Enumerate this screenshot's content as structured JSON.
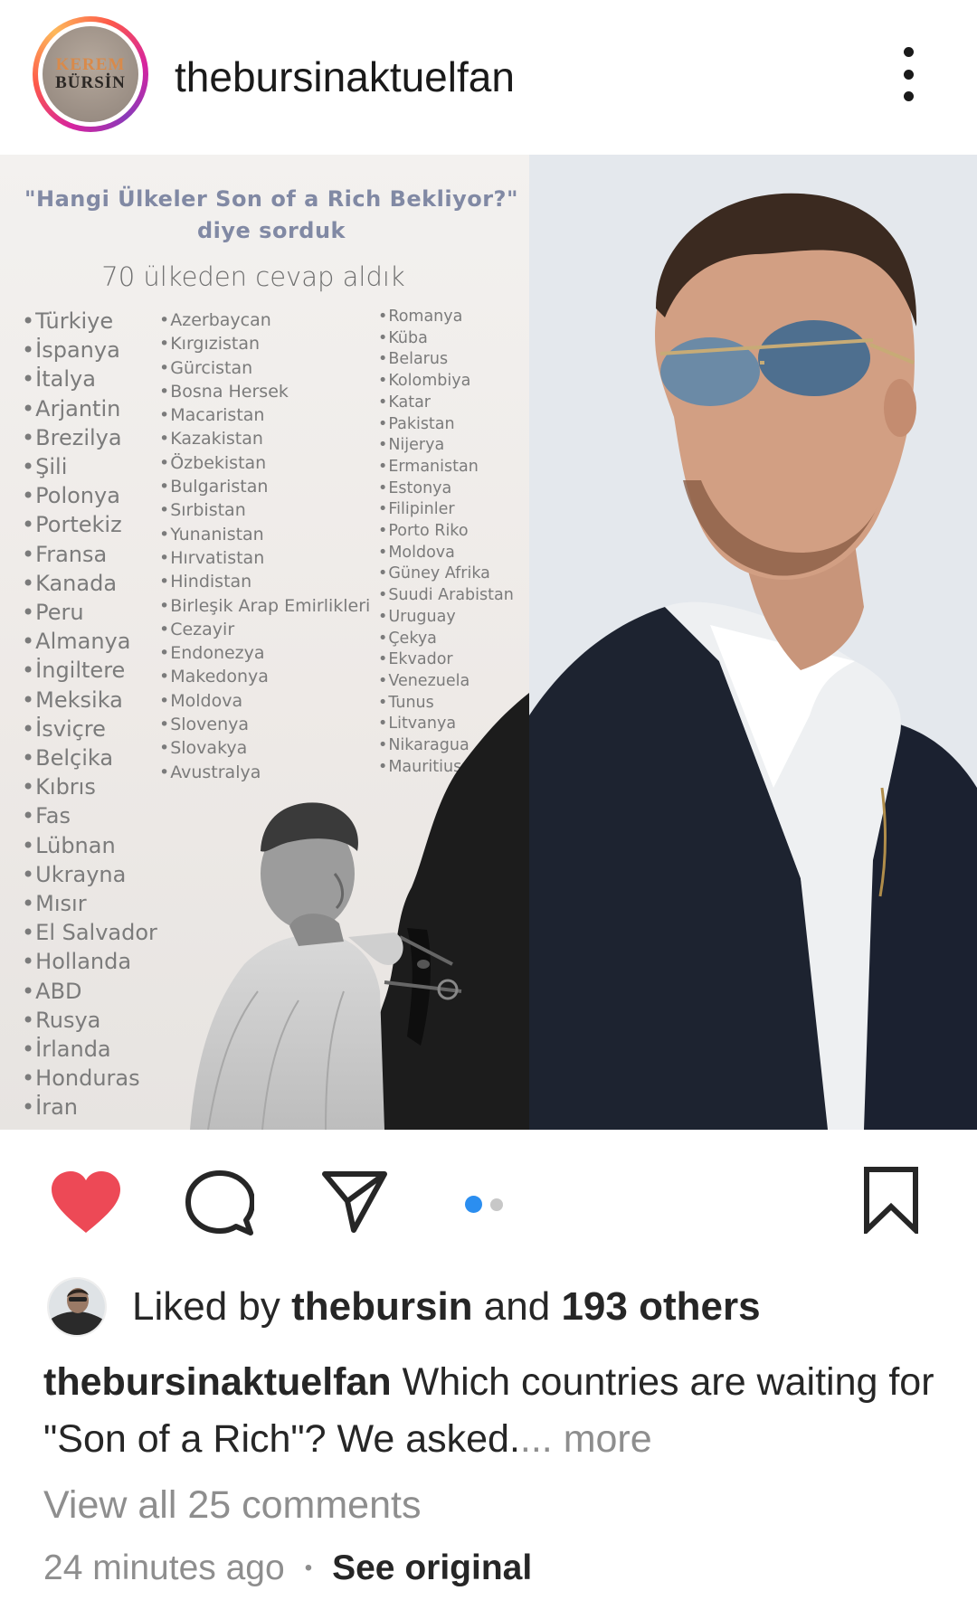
{
  "header": {
    "avatar_text_line1": "KEREM",
    "avatar_text_line2": "BÜRSİN",
    "username": "thebursinaktuelfan",
    "more_icon": "more-vertical-icon"
  },
  "post_image": {
    "question_line1": "\"Hangi Ülkeler Son of a Rich Bekliyor?\"",
    "question_line2": "diye sorduk",
    "subtitle": "70 ülkeden cevap aldık",
    "column1": [
      "Türkiye",
      "İspanya",
      "İtalya",
      "Arjantin",
      "Brezilya",
      "Şili",
      "Polonya",
      "Portekiz",
      "Fransa",
      "Kanada",
      "Peru",
      "Almanya",
      "İngiltere",
      "Meksika",
      "İsviçre",
      "Belçika",
      "Kıbrıs",
      "Fas",
      "Lübnan",
      "Ukrayna",
      "Mısır",
      "El Salvador",
      "Hollanda",
      "ABD",
      "Rusya",
      "İrlanda",
      "Honduras",
      "İran"
    ],
    "column2": [
      "Azerbaycan",
      "Kırgızistan",
      "Gürcistan",
      "Bosna Hersek",
      "Macaristan",
      "Kazakistan",
      "Özbekistan",
      "Bulgaristan",
      "Sırbistan",
      "Yunanistan",
      "Hırvatistan",
      "Hindistan",
      "Birleşik Arap Emirlikleri",
      "Cezayir",
      "Endonezya",
      "Makedonya",
      "Moldova",
      "Slovenya",
      "Slovakya",
      "Avustralya"
    ],
    "column3": [
      "Romanya",
      "Küba",
      "Belarus",
      "Kolombiya",
      "Katar",
      "Pakistan",
      "Nijerya",
      "Ermanistan",
      "Estonya",
      "Filipinler",
      "Porto Riko",
      "Moldova",
      "Güney Afrika",
      "Suudi Arabistan",
      "Uruguay",
      "Çekya",
      "Ekvador",
      "Venezuela",
      "Tunus",
      "Litvanya",
      "Nikaragua",
      "Mauritius"
    ]
  },
  "actions": {
    "like_icon": "heart-filled-icon",
    "comment_icon": "comment-icon",
    "share_icon": "send-icon",
    "save_icon": "bookmark-icon",
    "carousel_current": 1,
    "carousel_total": 2,
    "like_color": "#ed4956",
    "carousel_active_color": "#2b8ef0"
  },
  "likes": {
    "prefix": "Liked by ",
    "user": "thebursin",
    "middle": " and ",
    "count": "193 others"
  },
  "caption": {
    "username": "thebursinaktuelfan",
    "text": " Which countries are waiting for \"Son of a Rich\"? We asked.",
    "more": "... more"
  },
  "comments": {
    "view_all": "View all 25 comments"
  },
  "meta": {
    "time": "24 minutes ago",
    "separator": "•",
    "see_original": "See original"
  }
}
